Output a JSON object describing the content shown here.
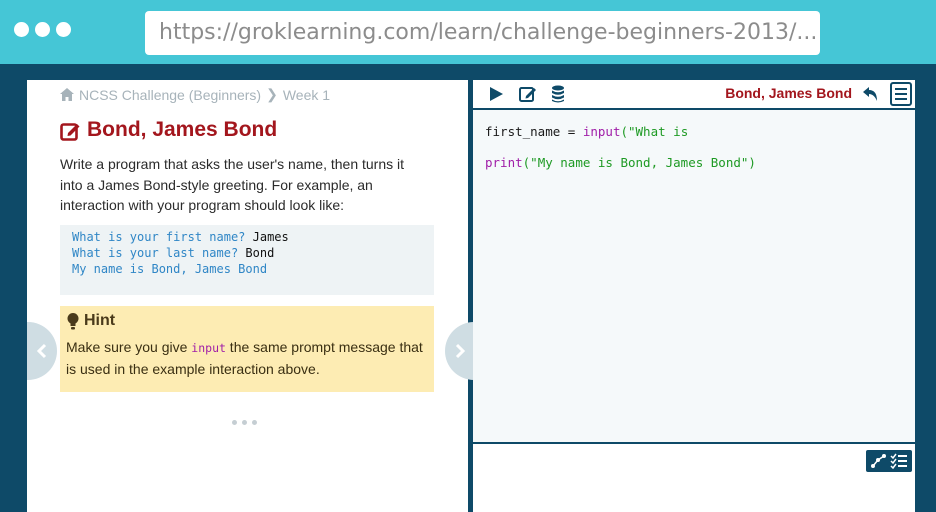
{
  "browser": {
    "url": "https://groklearning.com/learn/challenge-beginners-2013/..."
  },
  "problem": {
    "breadcrumb": [
      "NCSS Challenge (Beginners)",
      "Week 1"
    ],
    "title": "Bond, James Bond",
    "description": "Write a program that asks the user's name, then turns it into a James Bond-style greeting. For example, an interaction with your program should look like:",
    "example": [
      {
        "prompt": "What is your first name? ",
        "input": "James"
      },
      {
        "prompt": "What is your last name? ",
        "input": "Bond"
      },
      {
        "prompt": "My name is Bond, James Bond",
        "input": ""
      }
    ],
    "hint": {
      "title": "Hint",
      "text_before": "Make sure you give ",
      "code": "input",
      "text_after": " the same prompt message that is used in the example interaction above."
    }
  },
  "editor": {
    "file_title": "Bond, James Bond",
    "code": [
      {
        "plain": "first_name = ",
        "fn": "input",
        "args": "(\"What is"
      },
      {
        "plain": "",
        "fn": "print",
        "args": "(\"My name is Bond, James Bond\")"
      }
    ]
  },
  "colors": {
    "accent": "#a3161d",
    "frame": "#0e4a68",
    "chrome": "#45c6d6",
    "hint_bg": "#fdecb3"
  },
  "icons": [
    "home-icon",
    "edit-icon",
    "bulb-icon",
    "run-icon",
    "pencil-icon",
    "database-icon",
    "undo-icon",
    "menu-icon",
    "chart-icon",
    "checklist-icon"
  ]
}
